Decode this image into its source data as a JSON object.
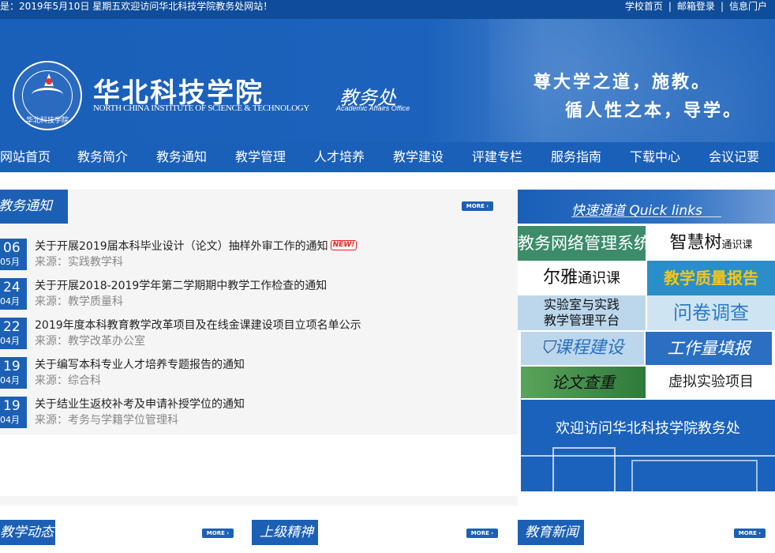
{
  "topbar": {
    "welcome": "是：2019年5月10日 星期五欢迎访问华北科技学院教务处网站！",
    "links": [
      "学校首页",
      "邮箱登录",
      "信息门户"
    ],
    "separator": "|"
  },
  "header": {
    "seal_text": "华北科技学院",
    "school_name": "华北科技学院",
    "school_name_en": "NORTH CHINA INSTITUTE OF SCIENCE & TECHNOLOGY",
    "office_name": "教务处",
    "office_name_en": "Academic Affairs Office",
    "motto_line1": "尊大学之道，施教。",
    "motto_line2": "循人性之本，导学。"
  },
  "nav": {
    "items": [
      "网站首页",
      "教务简介",
      "教务通知",
      "教学管理",
      "人才培养",
      "教学建设",
      "评建专栏",
      "服务指南",
      "下载中心",
      "会议记要"
    ]
  },
  "notice": {
    "tab": "教务通知",
    "more": "MORE",
    "items": [
      {
        "day": "06",
        "month": "05月",
        "title": "关于开展2019届本科毕业设计（论文）抽样外审工作的通知",
        "source": "来源：实践教学科",
        "new": "NEW!"
      },
      {
        "day": "24",
        "month": "04月",
        "title": "关于开展2018-2019学年第二学期期中教学工作检查的通知",
        "source": "来源：教学质量科"
      },
      {
        "day": "22",
        "month": "04月",
        "title": "2019年度本科教育教学改革项目及在线金课建设项目立项名单公示",
        "source": "来源：教学改革办公室"
      },
      {
        "day": "19",
        "month": "04月",
        "title": "关于编写本科专业人才培养专题报告的通知",
        "source": "来源：综合科"
      },
      {
        "day": "19",
        "month": "04月",
        "title": "关于结业生返校补考及申请补授学位的通知",
        "source": "来源：考务与学籍学位管理科"
      }
    ]
  },
  "quick": {
    "title": "快速通道 Quick links",
    "buttons": [
      {
        "label": "教务网络管理系统"
      },
      {
        "label": "智慧树",
        "sub": "通识课"
      },
      {
        "label": "尔雅",
        "sub": "通识课"
      },
      {
        "label": "教学质量报告"
      },
      {
        "label": "实验室与实践",
        "label2": "教学管理平台"
      },
      {
        "label": "问卷调查"
      },
      {
        "label": "课程建设"
      },
      {
        "label": "工作量填报"
      },
      {
        "label": "论文查重"
      },
      {
        "label": "虚拟实验项目"
      }
    ],
    "welcome": "欢迎访问华北科技学院教务处"
  },
  "sections": [
    {
      "label": "教学动态",
      "more": "MORE"
    },
    {
      "label": "上级精神",
      "more": "MORE"
    },
    {
      "label": "教育新闻",
      "more": "MORE"
    }
  ],
  "colors": {
    "primary": "#1c60b5",
    "topbar": "#0f4c99",
    "panel_bg": "#f5f5f5",
    "badge_red": "#e22222"
  }
}
